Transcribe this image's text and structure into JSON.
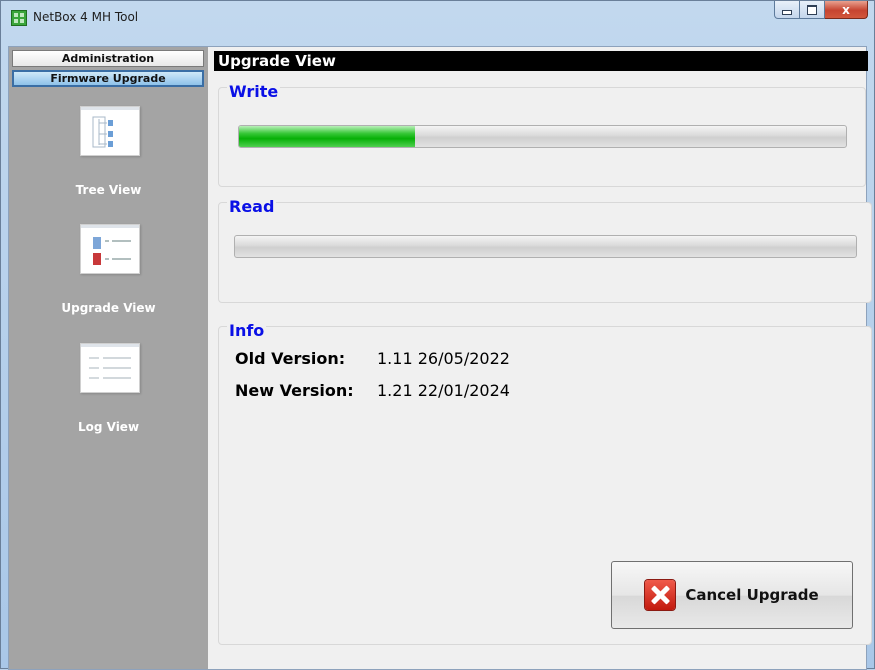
{
  "window": {
    "title": "NetBox 4 MH Tool",
    "controls": {
      "minimize": "minimize-icon",
      "maximize": "maximize-icon",
      "close": "x"
    }
  },
  "sidebar": {
    "top_buttons": [
      {
        "label": "Administration",
        "selected": false
      },
      {
        "label": "Firmware Upgrade",
        "selected": true
      }
    ],
    "nav": [
      {
        "label": "Tree View",
        "icon": "tree-view-icon"
      },
      {
        "label": "Upgrade View",
        "icon": "upgrade-view-icon"
      },
      {
        "label": "Log View",
        "icon": "log-view-icon"
      }
    ]
  },
  "main": {
    "header": "Upgrade View",
    "write": {
      "title": "Write",
      "progress_percent": 29
    },
    "read": {
      "title": "Read",
      "progress_percent": 0
    },
    "info": {
      "title": "Info",
      "rows": [
        {
          "label": "Old Version:",
          "value": "1.11 26/05/2022"
        },
        {
          "label": "New Version:",
          "value": "1.21 22/01/2024"
        }
      ]
    },
    "cancel_button": {
      "label": "Cancel Upgrade",
      "icon": "cancel-icon"
    }
  },
  "colors": {
    "group_title": "#0a10e6",
    "progress_fill": "#07b007",
    "sidebar_bg": "#a4a4a4",
    "header_bg": "#000000"
  }
}
